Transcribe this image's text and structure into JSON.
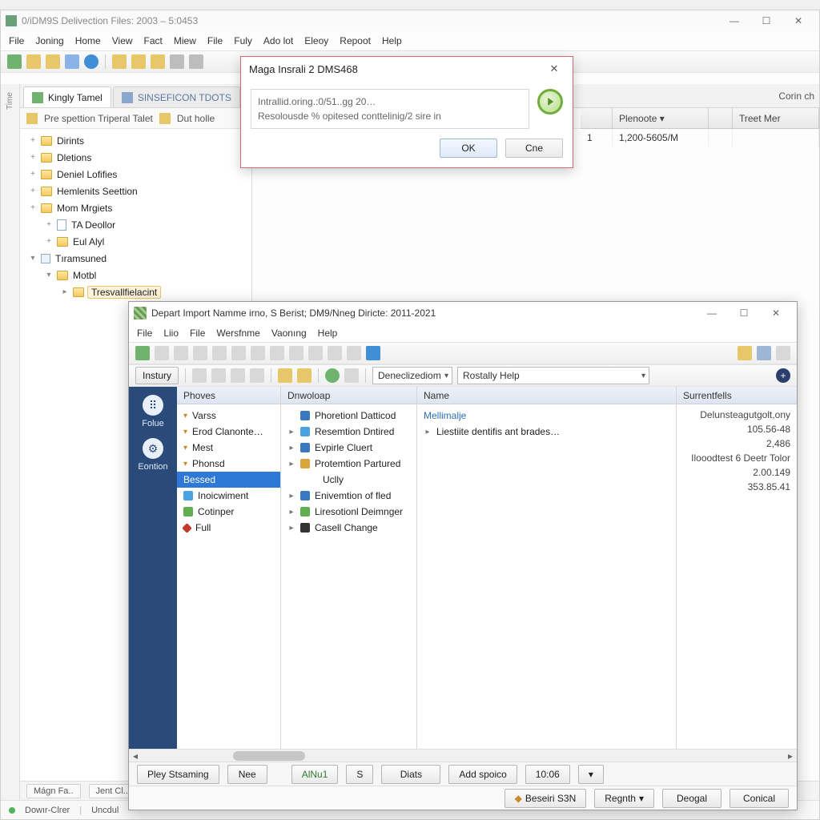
{
  "main": {
    "title": "0/iDM9S Delivection Files: 2003 – 5:0453",
    "menu": [
      "File",
      "Joning",
      "Home",
      "View",
      "Fact",
      "Miew",
      "File",
      "Fuly",
      "Ado lot",
      "Eleoy",
      "Repoot",
      "Help"
    ],
    "tabs": [
      {
        "label": "Kingly Tamel",
        "active": true
      },
      {
        "label": "SINSEFICON TDOTS",
        "active": false
      }
    ],
    "subbar": {
      "left_label": "Pre spettion Triperal Talet",
      "right_label": "Dut holle"
    },
    "tree": [
      {
        "indent": 0,
        "twisty": "+",
        "icon": "folder",
        "label": "Dirints"
      },
      {
        "indent": 0,
        "twisty": "+",
        "icon": "folder",
        "label": "Dletions"
      },
      {
        "indent": 0,
        "twisty": "+",
        "icon": "folder",
        "label": "Deniel Lofifies"
      },
      {
        "indent": 0,
        "twisty": "+",
        "icon": "folder",
        "label": "Hemlenits Seettion"
      },
      {
        "indent": 0,
        "twisty": "+",
        "icon": "folder",
        "label": "Mom Mrgiets"
      },
      {
        "indent": 1,
        "twisty": "+",
        "icon": "doc",
        "label": "TA Deollor"
      },
      {
        "indent": 1,
        "twisty": "+",
        "icon": "folder",
        "label": "Eul Alyl"
      },
      {
        "indent": 0,
        "twisty": "▾",
        "icon": "node",
        "label": "Tıramsuned"
      },
      {
        "indent": 1,
        "twisty": "▾",
        "icon": "folder",
        "label": "Motbl"
      },
      {
        "indent": 2,
        "twisty": "▸",
        "icon": "folder",
        "label": "Tresvallfielacint",
        "selected": true
      }
    ],
    "grid": {
      "headers": [
        "Plenoote ▾",
        "",
        "Treet Mer"
      ],
      "extra_header": "Corin ch",
      "row": [
        "1,200-5605/M",
        "",
        ""
      ]
    },
    "status_tabs": [
      "Mágn Fa..",
      "Jent Cl..",
      "",
      ""
    ],
    "status_lower": {
      "a": "Dowır-Clrer",
      "b": "Uncdul"
    }
  },
  "dialog": {
    "title": "Maga Insrali 2 DMS468",
    "line1": "Intrallid.oring.:0/51..gg 20…",
    "line2": "Resolousde % opitesed conttelinig/2 sire in",
    "ok": "OK",
    "cancel": "Cne"
  },
  "sec": {
    "title": "Depart Import Namme irno, S Berist; DM9/Nneg Diricte: 2011-2021",
    "menu": [
      "File",
      "Liio",
      "File",
      "Wersfnme",
      "Vaonıng",
      "Help"
    ],
    "tb2": {
      "left_label": "Instury",
      "combo1": "Deneclizediom",
      "combo2": "Rostally Help"
    },
    "navrail": [
      {
        "label": "Folue",
        "icon": "people"
      },
      {
        "label": "Eontion",
        "icon": "gear"
      }
    ],
    "cols": {
      "phones": {
        "header": "Phoves",
        "items": [
          {
            "tri": true,
            "label": "Varss"
          },
          {
            "tri": true,
            "label": "Erod Clanonte…"
          },
          {
            "tri": true,
            "label": "Mest"
          },
          {
            "tri": true,
            "label": "Phonsd"
          },
          {
            "sel": true,
            "label": "Bessed"
          },
          {
            "ico": "#4aa3e0",
            "label": "Inoicwiment"
          },
          {
            "ico": "#5fae4f",
            "label": "Cotinper"
          },
          {
            "ico": "#c0392b",
            "diamond": true,
            "label": "Full"
          }
        ]
      },
      "dnwoloap": {
        "header": "Dnwoloap",
        "items": [
          {
            "chev": "",
            "ico": "#3a78c2",
            "label": "Phoretionl Datticod"
          },
          {
            "chev": "▸",
            "ico": "#4aa3e0",
            "label": "Resemtion Dntired"
          },
          {
            "chev": "▸",
            "ico": "#3a78c2",
            "label": "Evpirle Cluert"
          },
          {
            "chev": "▸",
            "ico": "#d8a53a",
            "label": "Protemtion Partured"
          },
          {
            "chev": "",
            "ico": "",
            "label": "Uclly",
            "pad": true
          },
          {
            "chev": "▸",
            "ico": "#3a78c2",
            "label": "Enivemtion of fled"
          },
          {
            "chev": "▸",
            "ico": "#5fae4f",
            "label": "Liresotionl Deimnger"
          },
          {
            "chev": "▸",
            "ico": "#333",
            "label": "Casell Change"
          }
        ]
      },
      "name": {
        "header": "Name",
        "items": [
          {
            "link": true,
            "label": "Mellimalje"
          },
          {
            "chev": "▸",
            "label": "Liestiite dentifis ant brades…"
          }
        ]
      },
      "surren": {
        "header": "Surrentfells",
        "items": [
          "Delunsteagutgolt,ony",
          "105.56-48",
          "2,486",
          "Ilooodtest 6 Deetr Tolor",
          "2.00.149",
          "353.85.41"
        ]
      }
    },
    "foot1": {
      "play": "Pley Stsaming",
      "nee": "Nee",
      "alnu": "AlNu1",
      "s": "S",
      "diats": "Diats",
      "add": "Add spoico",
      "time": "10:06"
    },
    "foot2": {
      "beseiri": "Beseiri S3N",
      "regnth": "Regnth",
      "deogal": "Deogal",
      "conical": "Conical"
    }
  }
}
